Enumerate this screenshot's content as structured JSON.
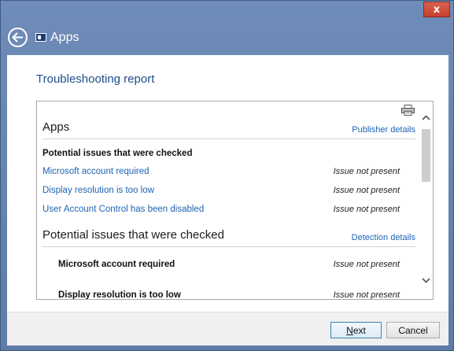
{
  "window": {
    "title": "Apps",
    "close_glyph": "x",
    "back_icon": "back-arrow-icon",
    "app_icon": "apps-icon"
  },
  "page": {
    "heading": "Troubleshooting report"
  },
  "report": {
    "printer_icon": "printer-icon",
    "app_section": {
      "title": "Apps",
      "details_link": "Publisher details",
      "subheading": "Potential issues that were checked",
      "items": [
        {
          "label": "Microsoft account required",
          "status": "Issue not present"
        },
        {
          "label": "Display resolution is too low",
          "status": "Issue not present"
        },
        {
          "label": "User Account Control has been disabled",
          "status": "Issue not present"
        }
      ]
    },
    "detection_section": {
      "title": "Potential issues that were checked",
      "details_link": "Detection details",
      "items": [
        {
          "label": "Microsoft account required",
          "status": "Issue not present"
        },
        {
          "label": "Display resolution is too low",
          "status": "Issue not present"
        }
      ]
    }
  },
  "buttons": {
    "next_first": "N",
    "next_rest": "ext",
    "cancel": "Cancel"
  },
  "colors": {
    "link": "#1d64b4",
    "heading": "#1e4d8c",
    "titlebar": "#6f8cb8",
    "close": "#c8402b"
  }
}
